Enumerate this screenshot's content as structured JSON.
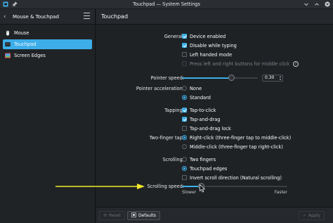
{
  "window": {
    "title": "Touchpad — System Settings"
  },
  "sidebar": {
    "title": "Mouse & Touchpad",
    "items": [
      {
        "label": "Mouse",
        "icon": "mouse-icon"
      },
      {
        "label": "Touchpad",
        "icon": "touchpad-icon",
        "selected": true
      },
      {
        "label": "Screen Edges",
        "icon": "screen-edges-icon"
      }
    ]
  },
  "main": {
    "title": "Touchpad",
    "general": {
      "label": "General:",
      "options": [
        {
          "label": "Device enabled",
          "checked": true
        },
        {
          "label": "Disable while typing",
          "checked": true
        },
        {
          "label": "Left handed mode",
          "checked": false
        },
        {
          "label": "Press left and right buttons for middle click",
          "checked": false,
          "disabled": true
        }
      ]
    },
    "pointer_speed": {
      "label": "Pointer speed:",
      "value": "0.30",
      "fraction": 0.65
    },
    "pointer_accel": {
      "label": "Pointer acceleration:",
      "options": [
        {
          "label": "None",
          "selected": false
        },
        {
          "label": "Standard",
          "selected": true
        }
      ]
    },
    "tapping": {
      "label": "Tapping:",
      "options": [
        {
          "label": "Tap-to-click",
          "checked": true
        },
        {
          "label": "Tap-and-drag",
          "checked": true
        },
        {
          "label": "Tap-and-drag lock",
          "checked": false
        }
      ]
    },
    "two_finger_tap": {
      "label": "Two-finger tap:",
      "options": [
        {
          "label": "Right-click (three-finger tap to middle-click)",
          "selected": true
        },
        {
          "label": "Middle-click (three-finger tap right-click)",
          "selected": false
        }
      ]
    },
    "scrolling": {
      "label": "Scrolling:",
      "options": [
        {
          "label": "Two fingers",
          "selected": false
        },
        {
          "label": "Touchpad edges",
          "selected": true
        },
        {
          "label": "Invert scroll direction (Natural scrolling)",
          "checked": false
        }
      ]
    },
    "scrolling_speed": {
      "label": "Scrolling speed:",
      "fraction": 0.18,
      "min_label": "Slower",
      "max_label": "Faster"
    }
  },
  "footer": {
    "reset": "Reset",
    "defaults": "Defaults",
    "apply": "Apply"
  },
  "colors": {
    "accent": "#3daee9",
    "annotation_arrow": "#f2e92b"
  }
}
